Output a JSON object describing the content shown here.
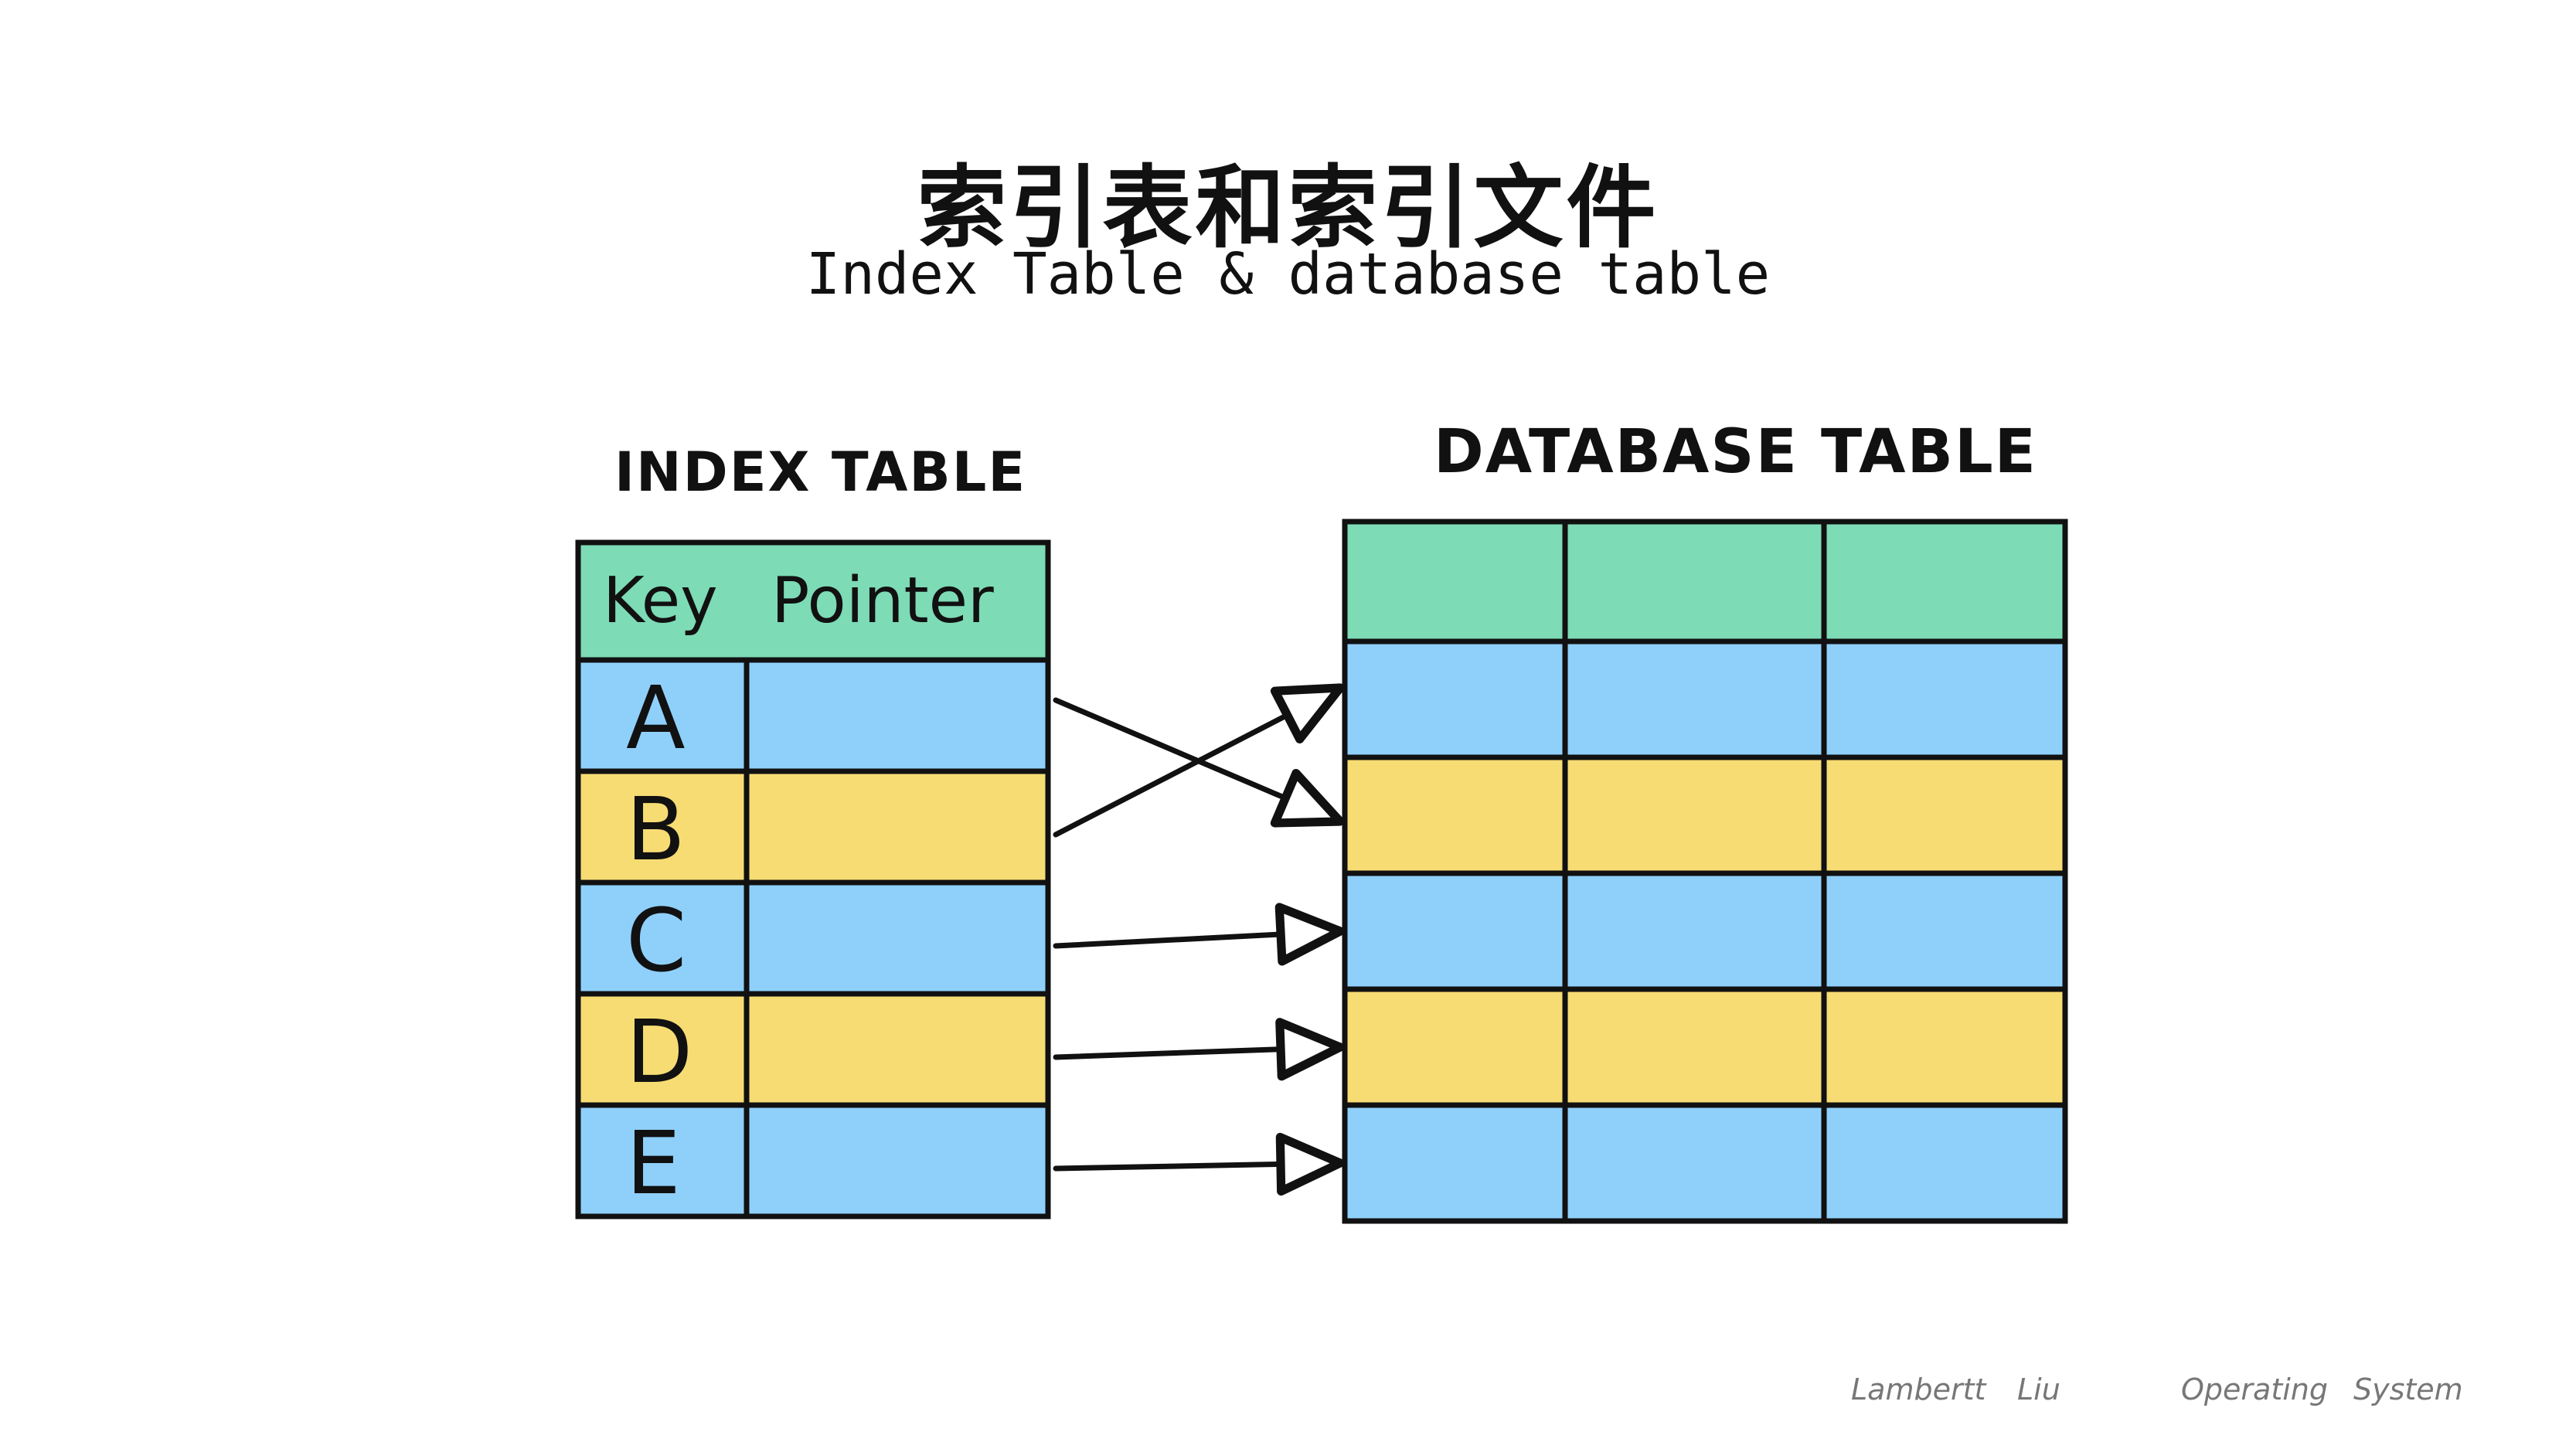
{
  "title": {
    "zh": "索引表和索引文件",
    "en": "Index Table & database table"
  },
  "index_table": {
    "label": "INDEX TABLE",
    "headers": [
      "Key",
      "Pointer"
    ],
    "keys": [
      "A",
      "B",
      "C",
      "D",
      "E"
    ]
  },
  "database_table": {
    "label": "DATABASE TABLE",
    "columns": 3,
    "rows": 6
  },
  "pointers": [
    {
      "key": "A",
      "db_row": 2
    },
    {
      "key": "B",
      "db_row": 1
    },
    {
      "key": "C",
      "db_row": 3
    },
    {
      "key": "D",
      "db_row": 4
    },
    {
      "key": "E",
      "db_row": 5
    }
  ],
  "colors": {
    "header": "#7ddbb6",
    "blue": "#8fd0fb",
    "yellow": "#f7dc74",
    "stroke": "#111111"
  },
  "footer": {
    "author_first": "Lambertt",
    "author_last": "Liu",
    "course_first": "Operating",
    "course_last": "System"
  }
}
